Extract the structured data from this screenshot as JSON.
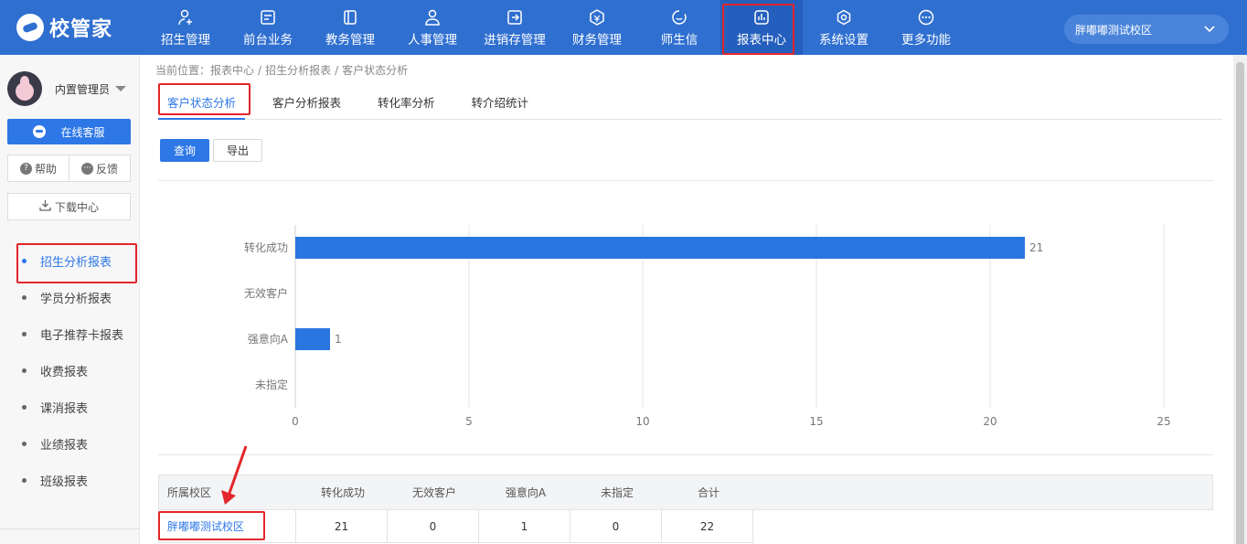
{
  "app": {
    "logo_text": "校管家"
  },
  "nav": {
    "items": [
      {
        "label": "招生管理",
        "icon": "user-plus-icon"
      },
      {
        "label": "前台业务",
        "icon": "desk-icon"
      },
      {
        "label": "教务管理",
        "icon": "book-icon"
      },
      {
        "label": "人事管理",
        "icon": "person-icon"
      },
      {
        "label": "进销存管理",
        "icon": "inventory-icon"
      },
      {
        "label": "财务管理",
        "icon": "finance-icon"
      },
      {
        "label": "师生信",
        "icon": "message-icon"
      },
      {
        "label": "报表中心",
        "icon": "report-icon"
      },
      {
        "label": "系统设置",
        "icon": "settings-icon"
      },
      {
        "label": "更多功能",
        "icon": "more-icon"
      }
    ],
    "active_index": 7
  },
  "campus_select": {
    "value": "胖嘟嘟测试校区"
  },
  "sidebar": {
    "user_name": "内置管理员",
    "service_label": "在线客服",
    "help_label": "帮助",
    "feedback_label": "反馈",
    "download_label": "下载中心",
    "menu": [
      {
        "label": "招生分析报表",
        "active": true
      },
      {
        "label": "学员分析报表"
      },
      {
        "label": "电子推荐卡报表"
      },
      {
        "label": "收费报表"
      },
      {
        "label": "课消报表"
      },
      {
        "label": "业绩报表"
      },
      {
        "label": "班级报表"
      }
    ]
  },
  "breadcrumb": {
    "prefix": "当前位置：",
    "items": [
      "报表中心",
      "招生分析报表",
      "客户状态分析"
    ]
  },
  "tabs": [
    {
      "label": "客户状态分析",
      "active": true
    },
    {
      "label": "客户分析报表"
    },
    {
      "label": "转化率分析"
    },
    {
      "label": "转介绍统计"
    }
  ],
  "actions": {
    "query_label": "查询",
    "export_label": "导出"
  },
  "chart_data": {
    "type": "bar",
    "orientation": "horizontal",
    "categories": [
      "转化成功",
      "无效客户",
      "强意向A",
      "未指定"
    ],
    "values": [
      21,
      0,
      1,
      0
    ],
    "xlim": [
      0,
      25
    ],
    "xticks": [
      0,
      5,
      10,
      15,
      20,
      25
    ],
    "grid": true,
    "color": "#2a76e0"
  },
  "table": {
    "headers": [
      "所属校区",
      "转化成功",
      "无效客户",
      "强意向A",
      "未指定",
      "合计"
    ],
    "rows": [
      [
        "胖嘟嘟测试校区",
        "21",
        "0",
        "1",
        "0",
        "22"
      ]
    ]
  },
  "colors": {
    "primary": "#2f6fd0",
    "accent": "#2d77e6",
    "highlight": "#e2262b"
  }
}
